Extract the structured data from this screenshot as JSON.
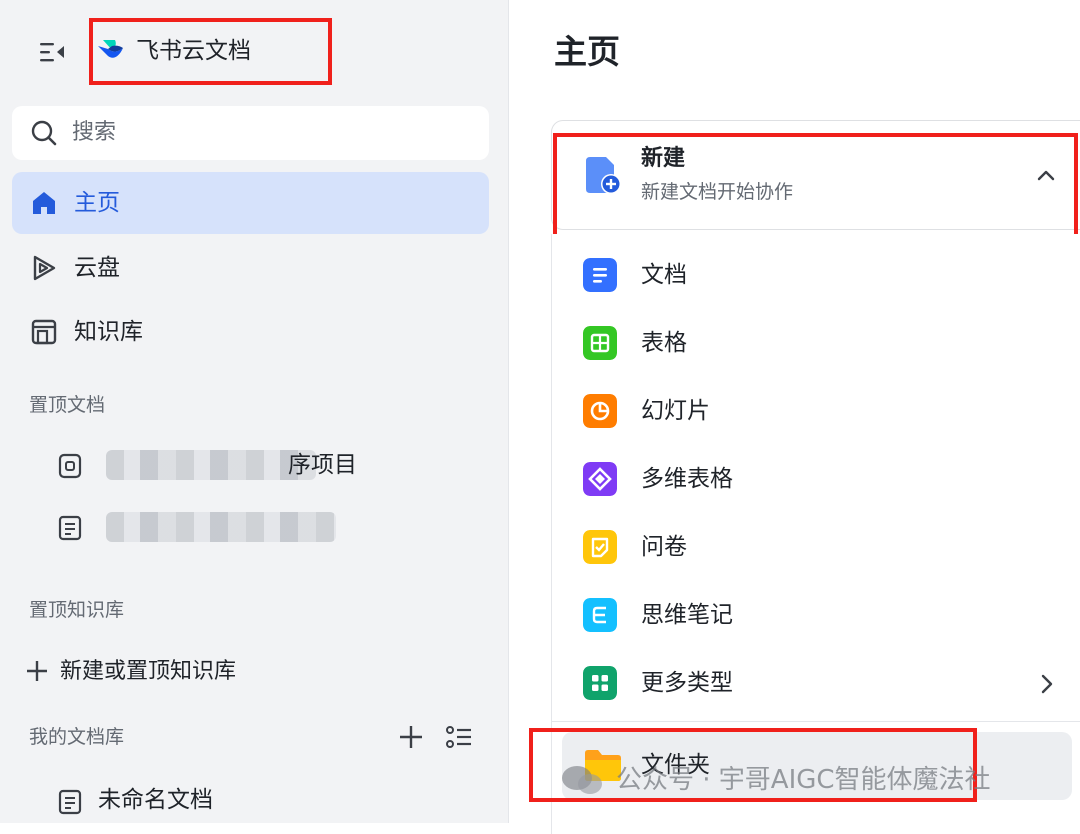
{
  "app": {
    "title": "飞书云文档"
  },
  "sidebar": {
    "search_placeholder": "搜索",
    "nav": [
      {
        "label": "主页",
        "icon": "home-icon",
        "active": true
      },
      {
        "label": "云盘",
        "icon": "cloud-drive-icon",
        "active": false
      },
      {
        "label": "知识库",
        "icon": "knowledge-base-icon",
        "active": false
      }
    ],
    "pinned_docs_header": "置顶文档",
    "pinned_docs": [
      {
        "label": "序项目",
        "icon": "project-doc-icon",
        "blurred": true
      },
      {
        "label": "",
        "icon": "doc-icon",
        "blurred": true
      }
    ],
    "pinned_kb_header": "置顶知识库",
    "add_kb_label": "新建或置顶知识库",
    "my_library_header": "我的文档库",
    "docs": [
      {
        "label": "未命名文档",
        "icon": "doc-icon"
      }
    ]
  },
  "main": {
    "title": "主页",
    "new_card": {
      "title": "新建",
      "subtitle": "新建文档开始协作"
    },
    "create_types": [
      {
        "label": "文档",
        "icon": "doc-type-icon",
        "color": "#3370ff"
      },
      {
        "label": "表格",
        "icon": "sheet-type-icon",
        "color": "#34c724"
      },
      {
        "label": "幻灯片",
        "icon": "slides-type-icon",
        "color": "#ff7d00"
      },
      {
        "label": "多维表格",
        "icon": "bitable-type-icon",
        "color": "#7f3bf5"
      },
      {
        "label": "问卷",
        "icon": "survey-type-icon",
        "color": "#ffc60a"
      },
      {
        "label": "思维笔记",
        "icon": "mindnote-type-icon",
        "color": "#14c0ff"
      },
      {
        "label": "更多类型",
        "icon": "more-types-icon",
        "color": "#10a36b"
      }
    ],
    "folder_label": "文件夹"
  },
  "watermark": {
    "text": "公众号 · 宇哥AIGC智能体魔法社"
  },
  "colors": {
    "accent": "#245bdb",
    "highlight_border": "#f0201b",
    "active_bg": "#d6e2fb"
  }
}
